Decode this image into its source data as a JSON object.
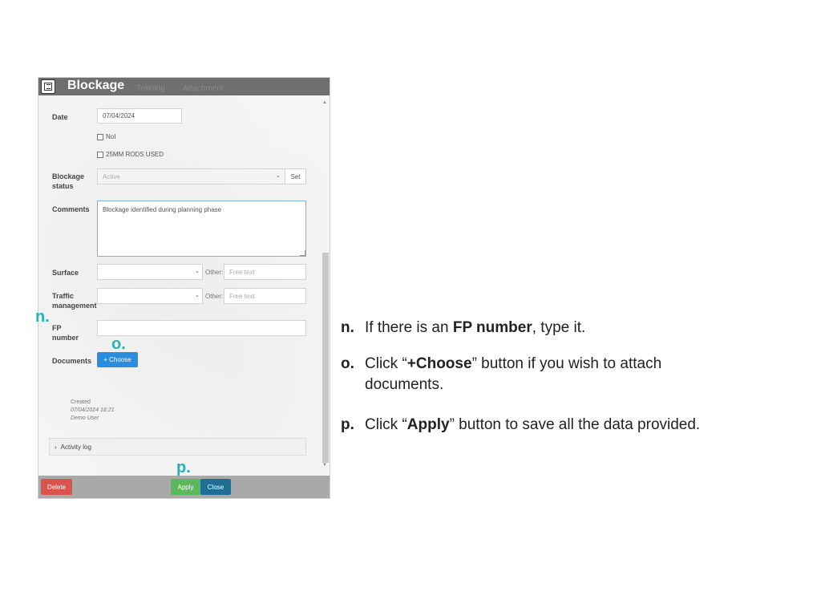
{
  "dialog": {
    "title": "Blockage",
    "tabs": [
      "Training",
      "Attachment"
    ],
    "fields": {
      "date": {
        "label": "Date",
        "value": "07/04/2024"
      },
      "checkboxes": [
        "NoI",
        "25MM RODS USED"
      ],
      "blockage_status": {
        "label": "Blockage status",
        "value": "Active",
        "button": "Set"
      },
      "comments": {
        "label": "Comments",
        "value": "Blockage identified during planning phase"
      },
      "surface": {
        "label": "Surface",
        "other_label": "Other:",
        "other_placeholder": "Free text"
      },
      "traffic": {
        "label": "Traffic management",
        "other_label": "Other:",
        "other_placeholder": "Free text"
      },
      "fp_number": {
        "label": "FP number",
        "value": ""
      },
      "documents": {
        "label": "Documents",
        "button": "+ Choose"
      }
    },
    "created": {
      "label": "Created",
      "datetime": "07/04/2024 18:21",
      "user": "Demo User"
    },
    "activity_log": "Activity log",
    "footer": {
      "delete": "Delete",
      "apply": "Apply",
      "close": "Close"
    },
    "colors": {
      "delete": "#d9534f",
      "apply": "#5cb85c",
      "close": "#1f6f94",
      "choose": "#2b8ddf",
      "marker": "#26b3b3"
    }
  },
  "markers": {
    "n": "n.",
    "o": "o.",
    "p": "p."
  },
  "instructions": [
    {
      "letter": "n.",
      "pre": "If there is an ",
      "bold": "FP number",
      "post": ",  type it."
    },
    {
      "letter": "o.",
      "pre": "Click “",
      "bold": "+Choose",
      "post": "” button if you wish to attach documents."
    },
    {
      "letter": "p.",
      "pre": "Click “",
      "bold": "Apply",
      "post": "” button to save all the data provided."
    }
  ]
}
